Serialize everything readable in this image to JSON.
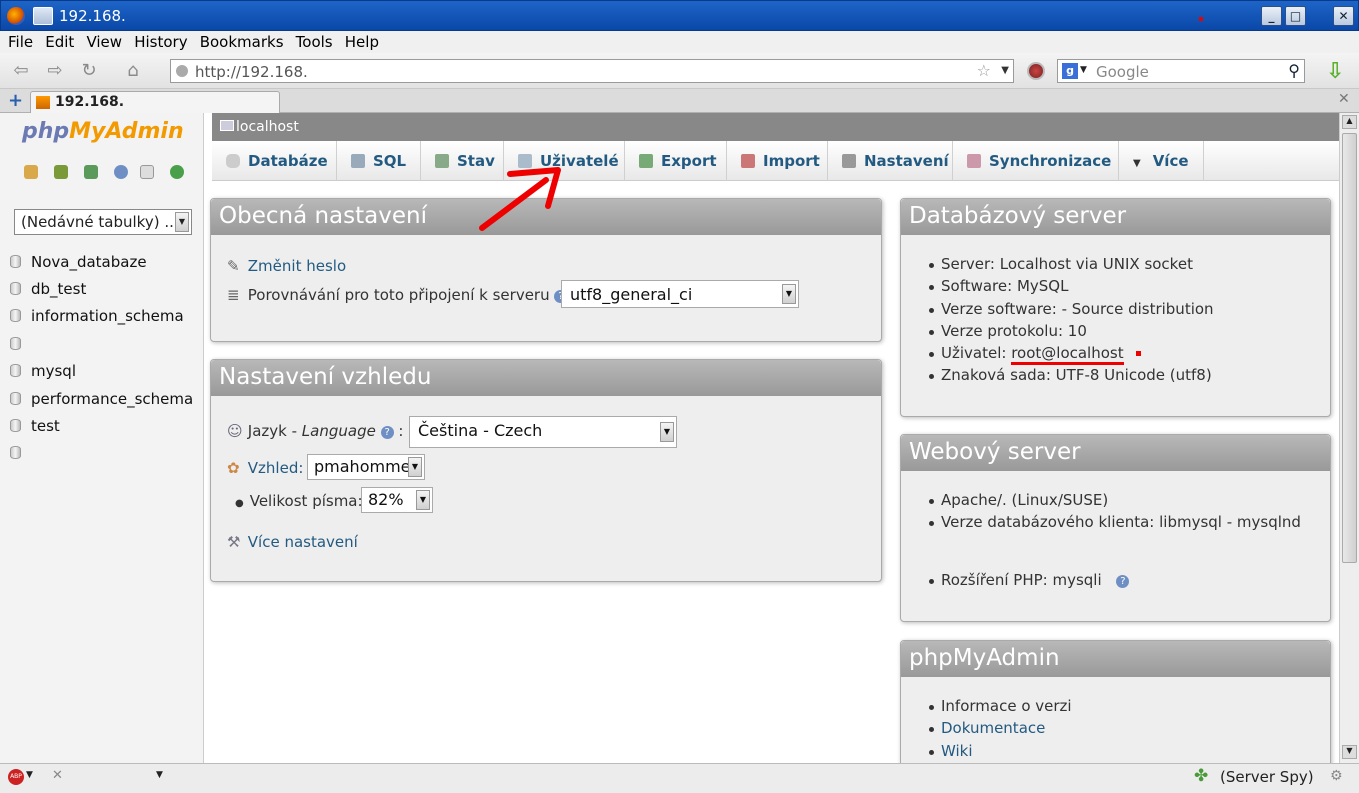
{
  "window": {
    "title": "192.168."
  },
  "menu": [
    "File",
    "Edit",
    "View",
    "History",
    "Bookmarks",
    "Tools",
    "Help"
  ],
  "nav": {
    "url": "http://192.168.",
    "search_placeholder": "Google"
  },
  "tab": {
    "title": "192.168."
  },
  "sidebar": {
    "logo_a": "php",
    "logo_b": "MyAdmin",
    "recent": "(Nedávné tabulky) ...",
    "databases": [
      "Nova_databaze",
      "db_test",
      "information_schema",
      "",
      "mysql",
      "performance_schema",
      "test",
      ""
    ]
  },
  "server_bar": "localhost",
  "topmenu": [
    "Databáze",
    "SQL",
    "Stav",
    "Uživatelé",
    "Export",
    "Import",
    "Nastavení",
    "Synchronizace",
    "Více"
  ],
  "general": {
    "title": "Obecná nastavení",
    "change_password": "Změnit heslo",
    "collation_label": "Porovnávání pro toto připojení k serveru",
    "collation_value": "utf8_general_ci"
  },
  "appearance": {
    "title": "Nastavení vzhledu",
    "language_label": "Jazyk - ",
    "language_label_em": "Language",
    "language_value": "Čeština - Czech",
    "theme_label": "Vzhled:",
    "theme_value": "pmahomme",
    "font_label": "Velikost písma:",
    "font_value": "82%",
    "more": "Více nastavení"
  },
  "db_server": {
    "title": "Databázový server",
    "items": [
      "Server: Localhost via UNIX socket",
      "Software: MySQL",
      "Verze software:                  - Source distribution",
      "Verze protokolu: 10"
    ],
    "user_label": "Uživatel: ",
    "user_value": "root@localhost",
    "charset": "Znaková sada: UTF-8 Unicode (utf8)"
  },
  "web_server": {
    "title": "Webový server",
    "items": [
      "Apache/.            (Linux/SUSE)",
      "Verze databázového klienta: libmysql - mysqlnd"
    ],
    "php_ext": "Rozšíření PHP: mysqli"
  },
  "pma": {
    "title": "phpMyAdmin",
    "version": "Informace o verzi",
    "docs": "Dokumentace",
    "wiki": "Wiki"
  },
  "status": {
    "server_spy": "(Server Spy)"
  }
}
